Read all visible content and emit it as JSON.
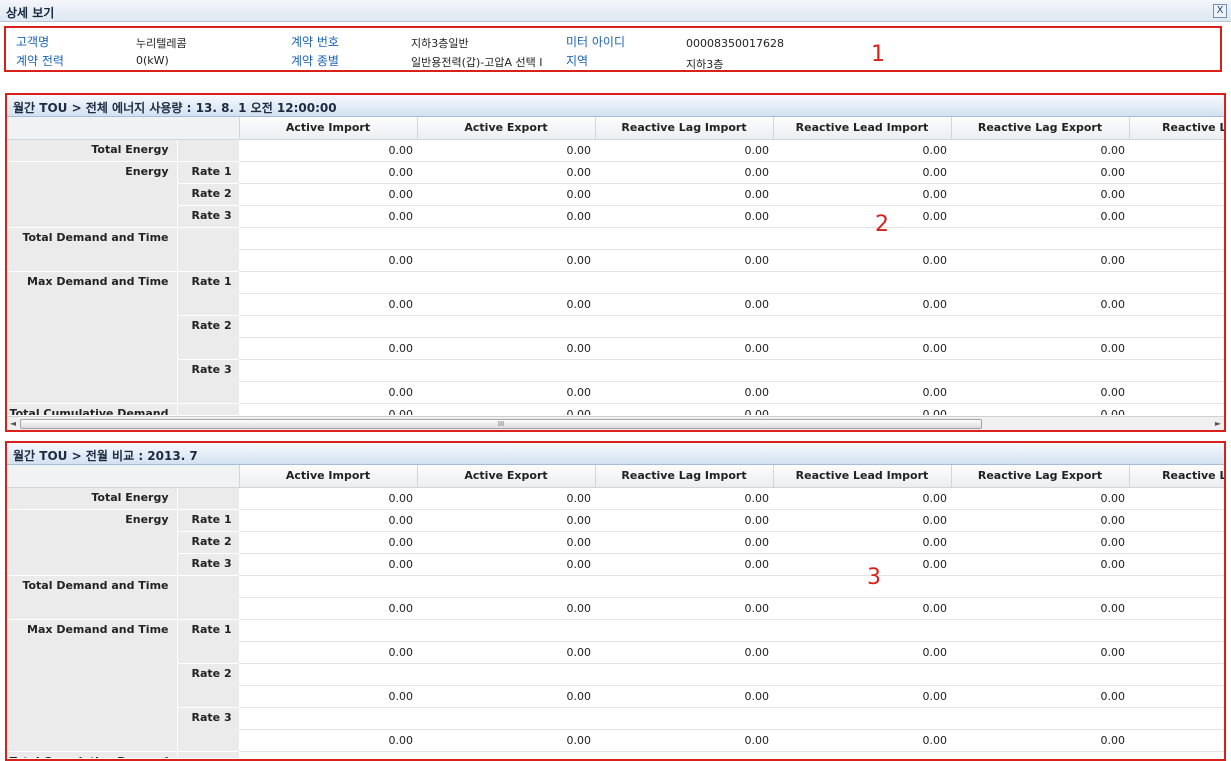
{
  "window": {
    "title": "상세 보기",
    "close_label": "X"
  },
  "info": {
    "customer_label": "고객명",
    "customer_value": "누리텔레콤",
    "contract_no_label": "계약 번호",
    "contract_no_value": "지하3층일반",
    "meter_id_label": "미터 아이디",
    "meter_id_value": "00008350017628",
    "contract_power_label": "계약 전력",
    "contract_power_value": "0(kW)",
    "contract_type_label": "계약 종별",
    "contract_type_value": "일반용전력(갑)-고압A 선택 I",
    "region_label": "지역",
    "region_value": "지하3층"
  },
  "annotations": [
    "1",
    "2",
    "3"
  ],
  "columns": [
    "Active Import",
    "Active Export",
    "Reactive Lag Import",
    "Reactive Lead Import",
    "Reactive Lag Export",
    "Reactive Le"
  ],
  "row_labels": {
    "total_energy": "Total Energy",
    "energy": "Energy",
    "total_demand": "Total Demand and Time",
    "max_demand": "Max Demand and Time",
    "rate1": "Rate 1",
    "rate2": "Rate 2",
    "rate3": "Rate 3",
    "cumulative_partial": "Total Cumulative Demand"
  },
  "cell_value": "0.00",
  "panel1": {
    "title": "월간 TOU > 전체 에너지 사용량 : 13. 8. 1 오전 12:00:00"
  },
  "panel2": {
    "title": "월간 TOU > 전월 비교 : 2013. 7"
  },
  "scrollbar": {
    "left_arrow": "◄",
    "right_arrow": "►",
    "grip": "III"
  }
}
